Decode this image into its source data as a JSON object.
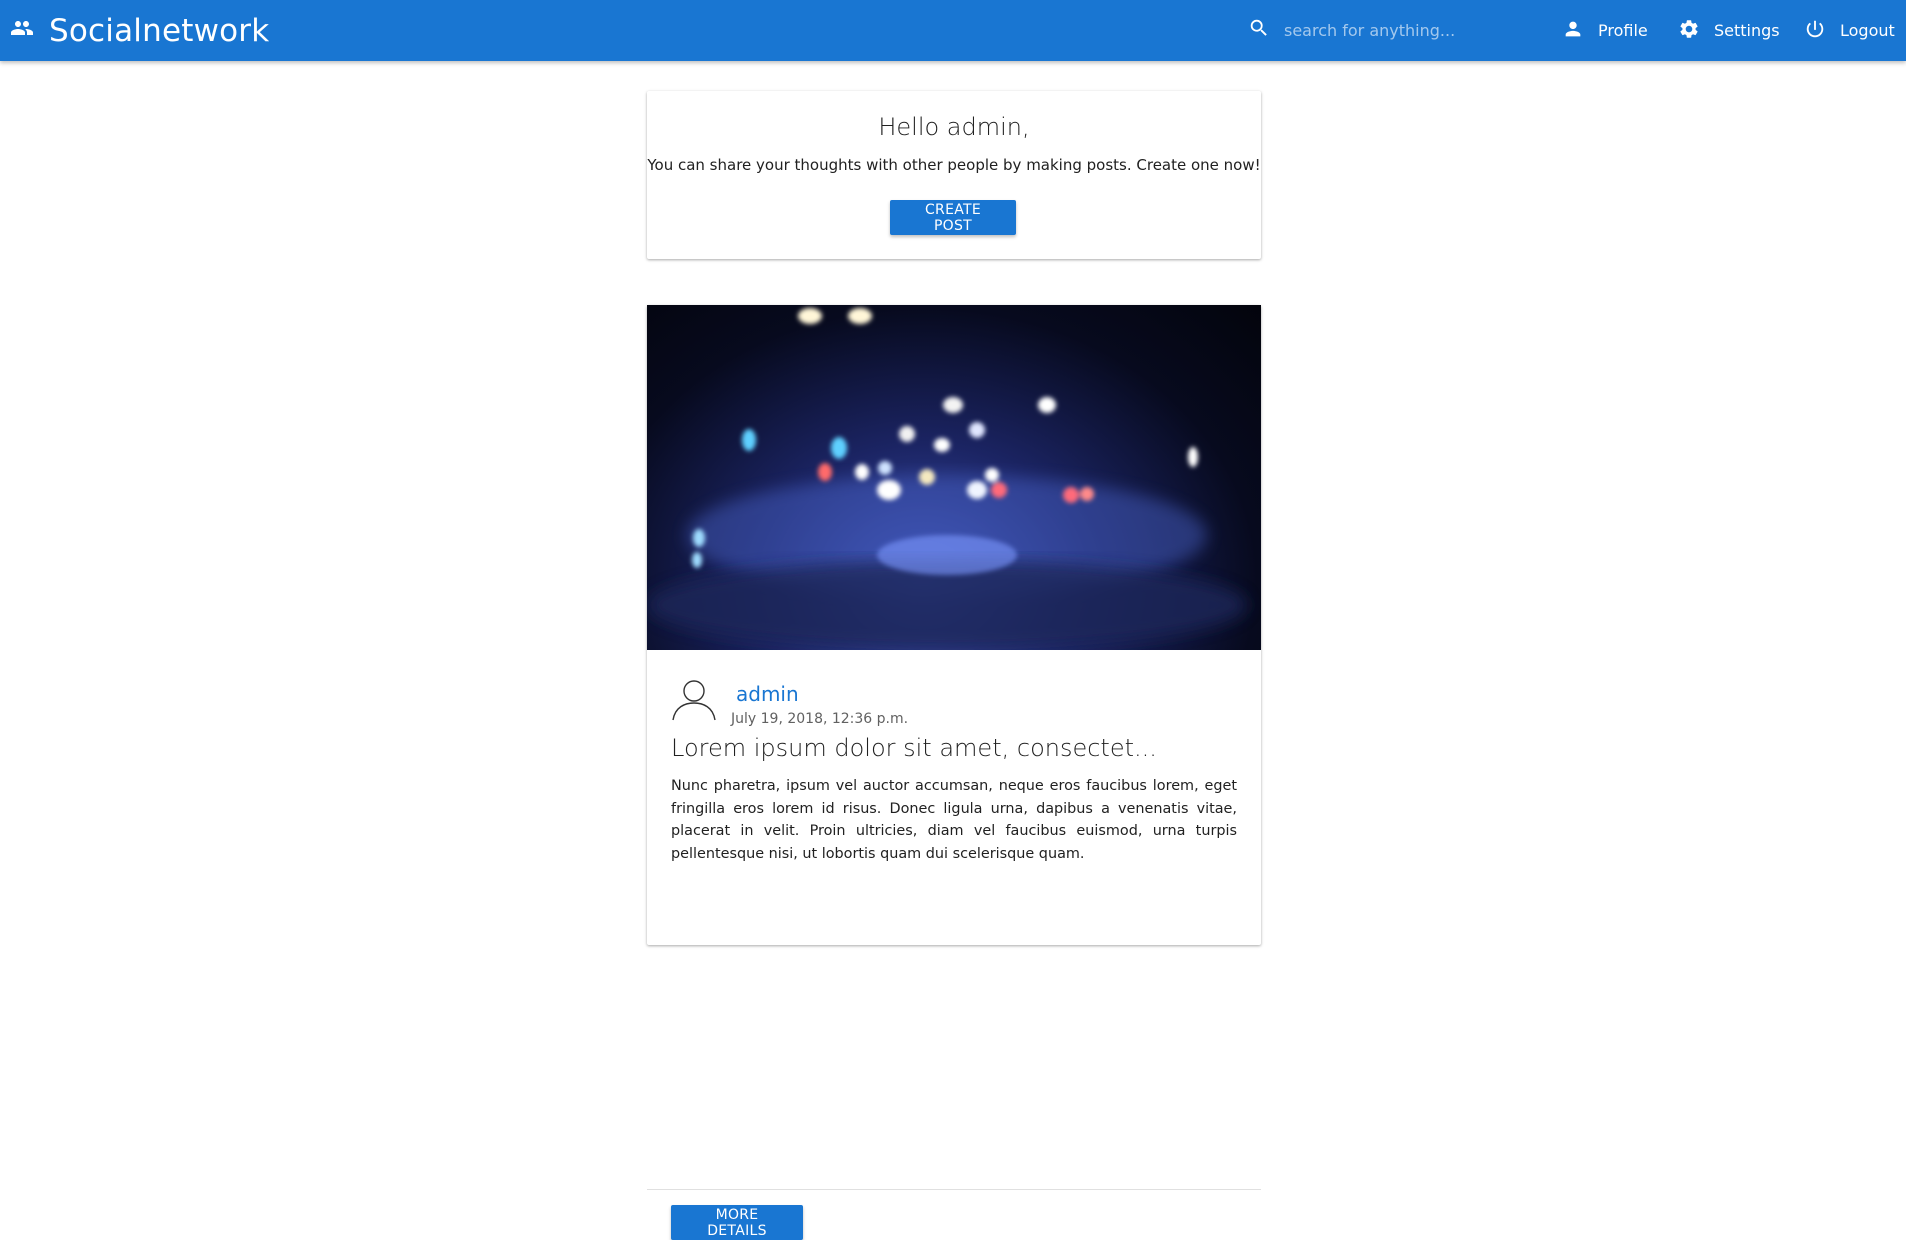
{
  "header": {
    "brand": "Socialnetwork",
    "brand_icon": "people-icon",
    "search_placeholder": "search for anything...",
    "nav": {
      "profile": "Profile",
      "settings": "Settings",
      "logout": "Logout"
    },
    "color": "#1976d2"
  },
  "welcome": {
    "title": "Hello admin,",
    "text": "You can share your thoughts with other people by making posts. Create one now!",
    "button": "CREATE POST"
  },
  "post": {
    "author": "admin",
    "date": "July 19, 2018, 12:36 p.m.",
    "title": "Lorem ipsum dolor sit amet, consectet...",
    "text": "Nunc pharetra, ipsum vel auctor accumsan, neque eros faucibus lorem, eget fringilla eros lorem id risus. Donec ligula urna, dapibus a venenatis vitae, placerat in velit. Proin ultricies, diam vel faucibus euismod, urna turpis pellentesque nisi, ut lobortis quam dui scelerisque quam.",
    "button": "MORE DETAILS",
    "image": "blurred night street photo"
  }
}
